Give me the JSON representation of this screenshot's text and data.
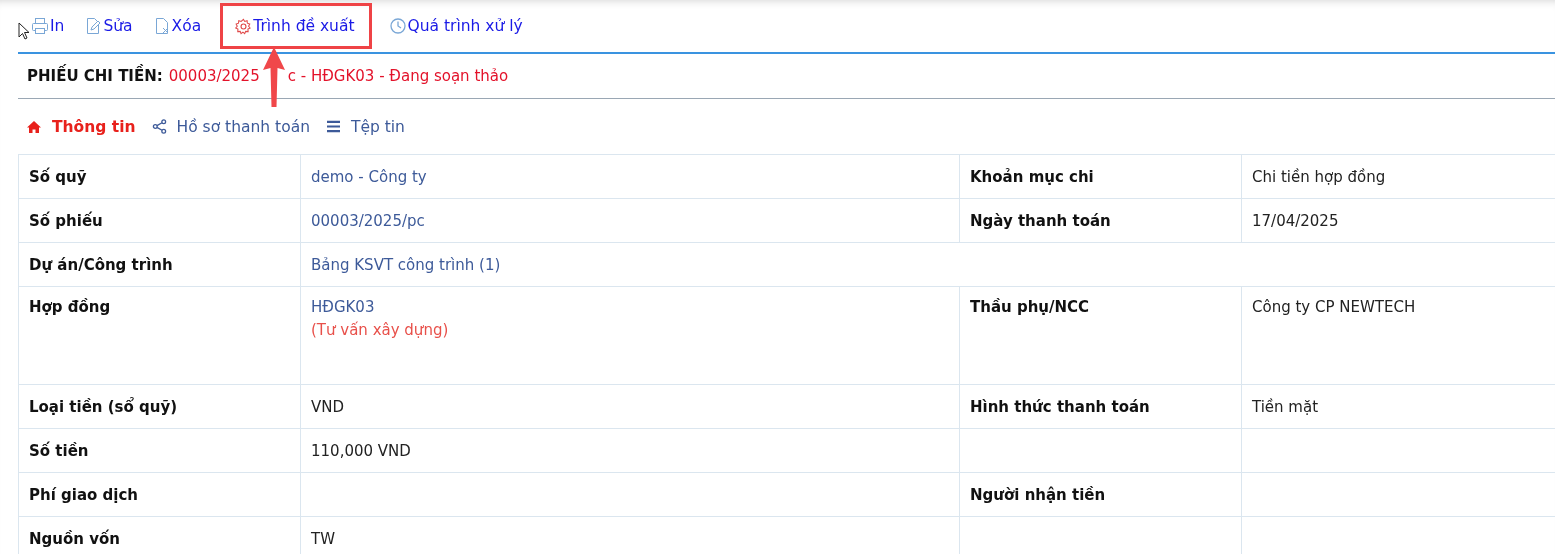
{
  "toolbar": [
    {
      "kind": "print",
      "label": "In",
      "annotated": false
    },
    {
      "kind": "edit",
      "label": "Sửa",
      "annotated": false
    },
    {
      "kind": "delete",
      "label": "Xóa",
      "annotated": false
    },
    {
      "kind": "gear",
      "label": "Trình đề xuất",
      "annotated": true
    },
    {
      "kind": "history",
      "label": "Quá trình xử lý",
      "annotated": false
    }
  ],
  "document": {
    "title": "PHIẾU CHI TIỀN:",
    "value": "00003/2025",
    "value_after_arrow": "c - HĐGK03 - Đang soạn thảo"
  },
  "tabs": [
    {
      "kind": "home",
      "label": "Thông tin",
      "selected": true
    },
    {
      "kind": "share",
      "label": "Hồ sơ thanh toán",
      "selected": false
    },
    {
      "kind": "list",
      "label": "Tệp tin",
      "selected": false
    }
  ],
  "rows": [
    {
      "label": "Số quỹ",
      "value": "demo - Công ty",
      "kind": "link",
      "label_2": "Khoản mục chi",
      "value_2": "Chi tiền hợp đồng"
    },
    {
      "label": "Số phiếu",
      "value": "00003/2025/pc",
      "kind": "link",
      "label_2": "Ngày thanh toán",
      "value_2": "17/04/2025"
    },
    {
      "label": "Dự án/Công trình",
      "value": "Bảng KSVT công trình (1)",
      "kind": "link",
      "span": true
    },
    {
      "label": "Hợp đồng",
      "value": "HĐGK03",
      "kind": "link",
      "note": "(Tư vấn xây dựng)",
      "label_2": "Thầu phụ/NCC",
      "value_2": "Công ty CP NEWTECH"
    },
    {
      "label": "Loại tiền (sổ quỹ)",
      "value": "VND",
      "kind": "plain",
      "label_2": "Hình thức thanh toán",
      "value_2": "Tiền mặt"
    },
    {
      "label": "Số tiền",
      "value": "110,000 VND",
      "kind": "plain"
    },
    {
      "label": "Phí giao dịch",
      "label_2": "Người nhận tiền"
    },
    {
      "label": "Nguồn vốn",
      "value": "TW",
      "kind": "plain"
    }
  ]
}
